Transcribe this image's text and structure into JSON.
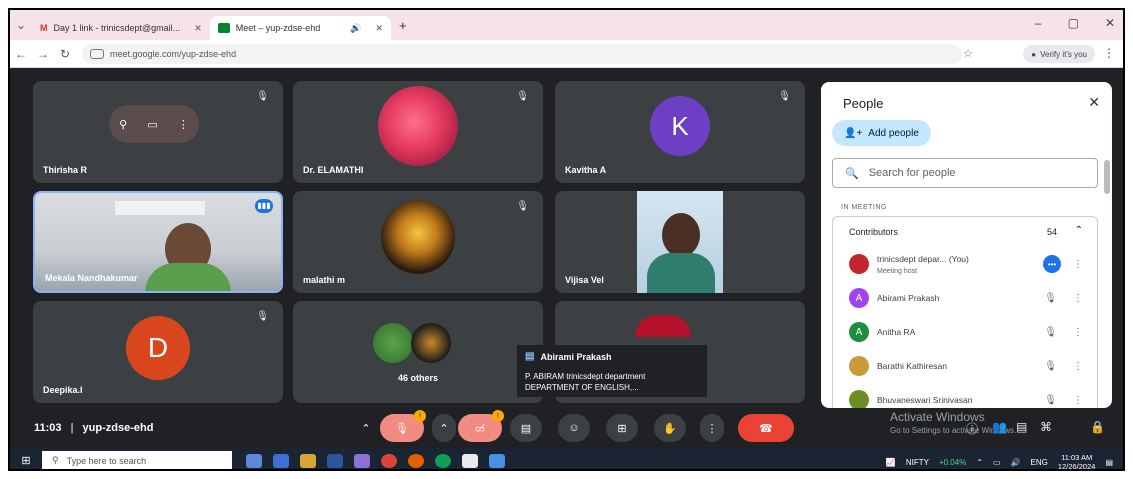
{
  "browser": {
    "tabs": [
      {
        "icon": "gmail-icon",
        "title": "Day 1 link - trinicsdept@gmail...",
        "close": "✕"
      },
      {
        "icon": "meet-icon",
        "title": "Meet – yup-zdse-ehd",
        "audio": "🔊",
        "close": "✕"
      }
    ],
    "new_tab": "+",
    "url": "meet.google.com/yup-zdse-ehd",
    "verify_label": "Verify it's you"
  },
  "tiles": [
    {
      "name": "Thirisha R",
      "type": "controls"
    },
    {
      "name": "Dr. ELAMATHI",
      "type": "photo",
      "color": "#e3385f"
    },
    {
      "name": "Kavitha A",
      "type": "letter",
      "letter": "K",
      "color": "#6d3fc4"
    },
    {
      "name": "Mekala Nandhakumar",
      "type": "video",
      "speaking": true
    },
    {
      "name": "malathi m",
      "type": "photo",
      "color": "#c07a1a"
    },
    {
      "name": "Vijisa Vel",
      "type": "video"
    },
    {
      "name": "Deepika.I",
      "type": "letter",
      "letter": "D",
      "color": "#d9461e"
    },
    {
      "name": "46 others",
      "type": "others"
    }
  ],
  "people_panel": {
    "title": "People",
    "add_people_label": "Add people",
    "search_placeholder": "Search for people",
    "section_label": "IN MEETING",
    "contributors_label": "Contributors",
    "contributors_count": "54",
    "people": [
      {
        "name": "trinicsdept depar...",
        "you": "(You)",
        "sub": "Meeting host",
        "avatar_color": "#c0262d",
        "avatar_letter": ""
      },
      {
        "name": "Abirami Prakash",
        "avatar_letter": "A",
        "avatar_color": "#a142f4"
      },
      {
        "name": "Anitha RA",
        "avatar_letter": "A",
        "avatar_color": "#1e8e3e"
      },
      {
        "name": "Barathi Kathiresan",
        "avatar_letter": "",
        "avatar_color": "#c99a3b"
      },
      {
        "name": "Bhuvaneswari Srinivasan",
        "avatar_letter": "",
        "avatar_color": "#6b8e23"
      }
    ]
  },
  "toast": {
    "sender": "Abirami Prakash",
    "line1": "P. ABIRAM trinicsdept department",
    "line2": "DEPARTMENT OF ENGLISH,..."
  },
  "controls": {
    "time": "11:03",
    "separator": "|",
    "meeting_code": "yup-zdse-ehd",
    "warn_badge": "!",
    "activate_title": "Activate Windows",
    "activate_sub": "Go to Settings to activate Windows."
  },
  "taskbar": {
    "search_placeholder": "Type here to search",
    "nifty_label": "NIFTY",
    "nifty_value": "+0.04%",
    "lang": "ENG",
    "time": "11:03 AM",
    "date": "12/26/2024"
  }
}
